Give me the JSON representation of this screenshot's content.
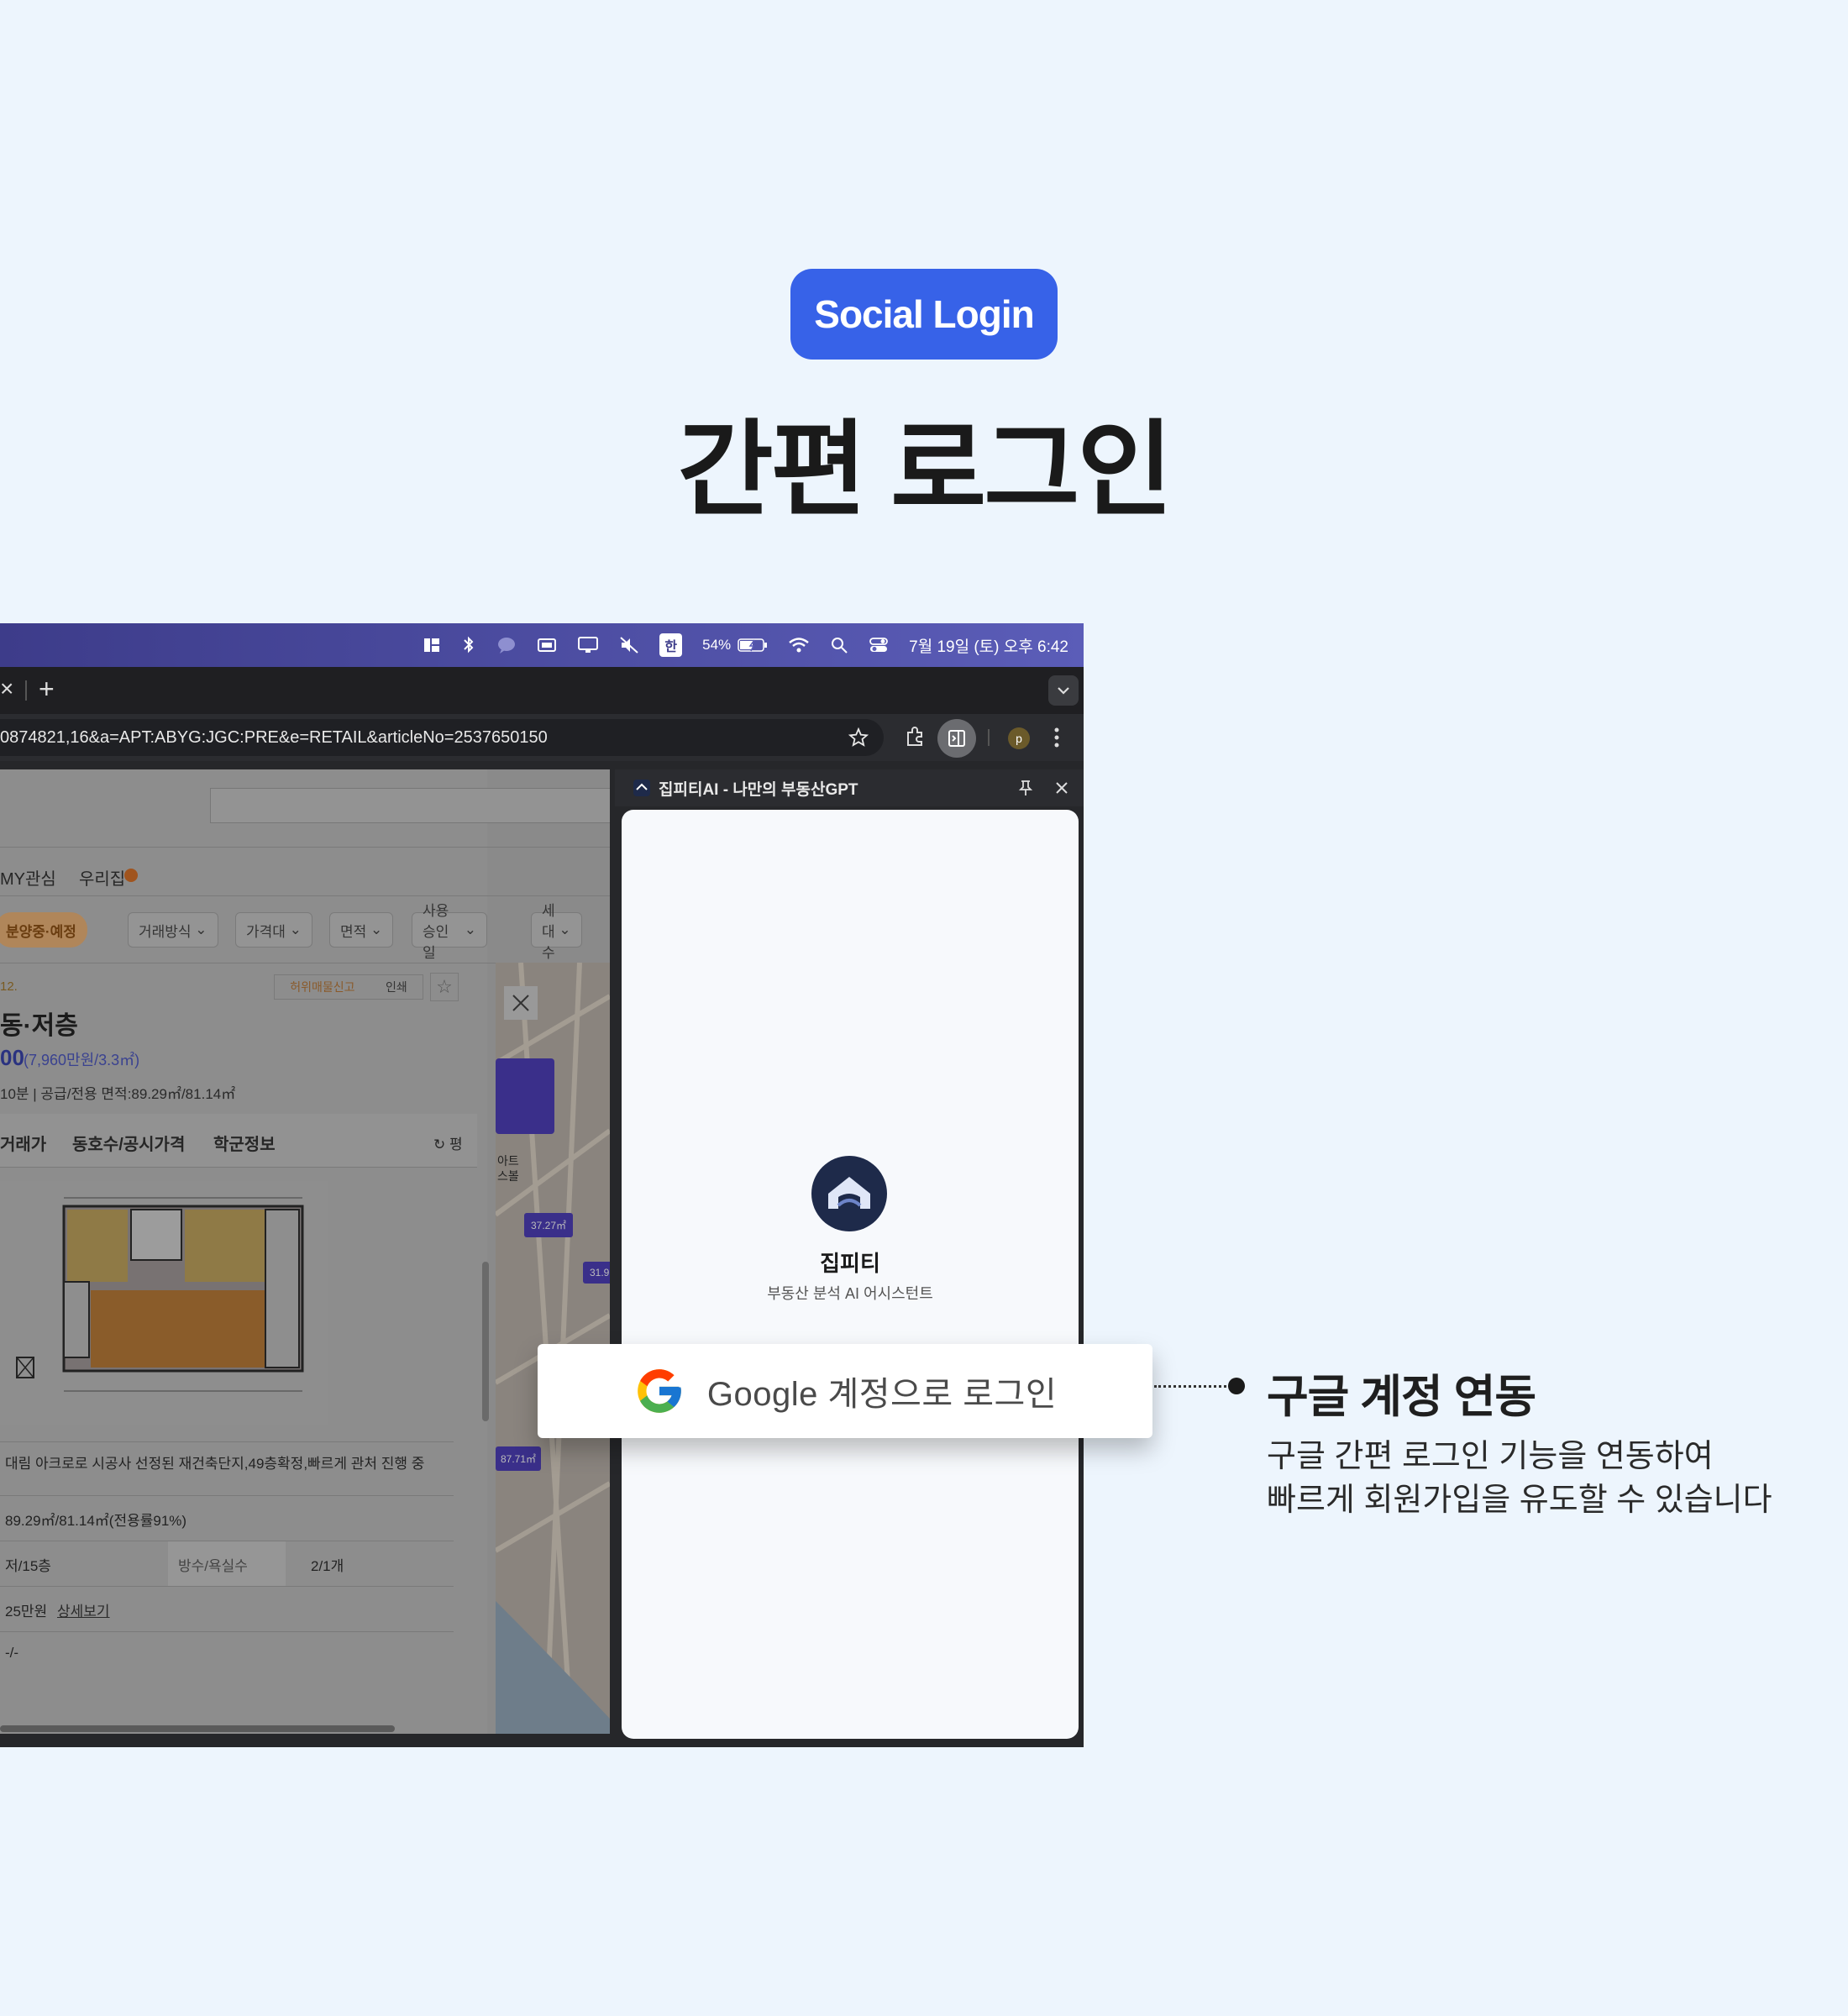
{
  "header": {
    "badge": "Social Login",
    "title": "간편 로그인"
  },
  "menubar": {
    "input_method": "한",
    "battery": "54%",
    "datetime": "7월 19일 (토) 오후 6:42"
  },
  "tabbar": {
    "close": "×",
    "new_tab": "+"
  },
  "address_bar": {
    "url": "0874821,16&a=APT:ABYG:JGC:PRE&e=RETAIL&articleNo=2537650150",
    "profile_initial": "p"
  },
  "website": {
    "nav": [
      "MY관심",
      "우리집"
    ],
    "filters": [
      "분양중·예정",
      "거래방식",
      "가격대",
      "면적",
      "사용승인일",
      "세대수"
    ],
    "date_fragment": "12.",
    "report_label": "허위매물신고",
    "print_label": "인쇄",
    "listing_title": "동·저층",
    "price_fragment": "00",
    "price_per_area": "(7,960만원/3.3㎡)",
    "meta": "10분 | 공급/전용 면적:89.29㎡/81.14㎡",
    "tabs": [
      "거래가",
      "동호수/공시가격",
      "학군정보"
    ],
    "unit_toggle": "평",
    "description": "대림 아크로로 시공사 선정된 재건축단지,49층확정,빠르게 관처 진행 중",
    "rows": [
      {
        "value": "89.29㎡/81.14㎡(전용률91%)"
      },
      {
        "value": "저/15층",
        "label2": "방수/욕실수",
        "value2": "2/1개"
      },
      {
        "value": "25만원",
        "link": "상세보기"
      },
      {
        "value": "-/-"
      }
    ],
    "map_labels": [
      "37.27㎡",
      "31.9",
      "87.71㎡",
      "아트",
      "스볼"
    ]
  },
  "side_panel": {
    "title": "집피티AI - 나만의 부동산GPT",
    "app_name": "집피티",
    "app_subtitle": "부동산 분석 AI 어시스턴트"
  },
  "google_button": {
    "label": "Google 계정으로 로그인"
  },
  "feature": {
    "title": "구글 계정 연동",
    "desc_line1": "구글 간편 로그인 기능을 연동하여",
    "desc_line2": "빠르게 회원가입을 유도할 수 있습니다"
  },
  "colors": {
    "background": "#edf5fd",
    "badge": "#3762e8",
    "menubar_start": "#3d3c8a",
    "menubar_end": "#5b5db8",
    "app_logo": "#1e2a4a"
  }
}
